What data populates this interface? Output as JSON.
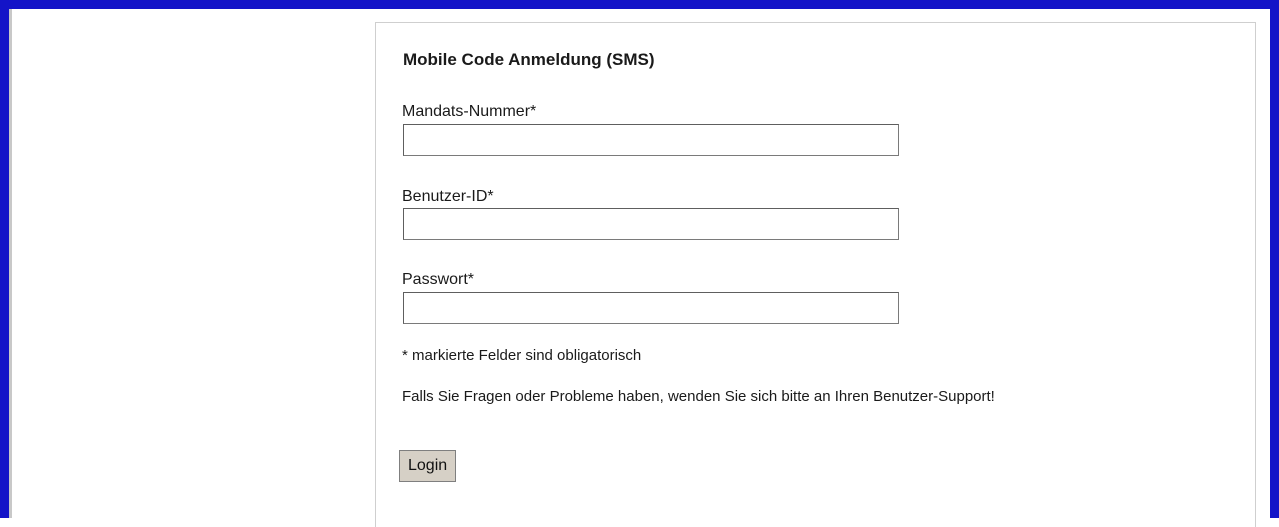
{
  "form": {
    "title": "Mobile Code Anmeldung (SMS)",
    "fields": [
      {
        "label": "Mandats-Nummer*",
        "value": ""
      },
      {
        "label": "Benutzer-ID*",
        "value": ""
      },
      {
        "label": "Passwort*",
        "value": ""
      }
    ],
    "required_note": "* markierte Felder sind obligatorisch",
    "support_note": "Falls Sie Fragen oder Probleme haben, wenden Sie sich bitte an Ihren Benutzer-Support!",
    "login_label": "Login"
  },
  "colors": {
    "frame_border": "#1414c8",
    "button_bg": "#d6d0c6"
  }
}
